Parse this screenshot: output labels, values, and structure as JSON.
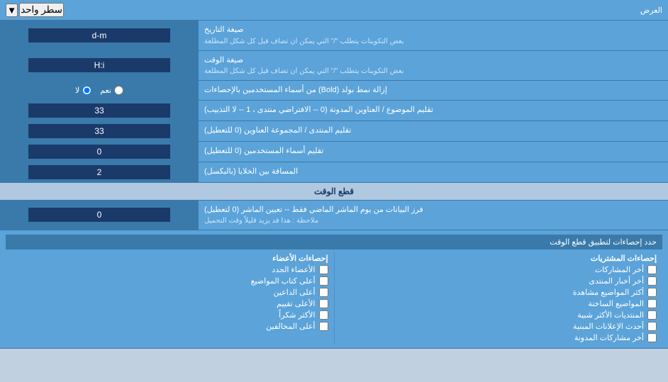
{
  "header": {
    "label": "العرض",
    "dropdown_label": "سطر واحد",
    "dropdown_arrow": "▼"
  },
  "rows": [
    {
      "id": "date_format",
      "label": "صيغة التاريخ",
      "sublabel": "بعض التكوينات يتطلب \"/\" التي يمكن ان تضاف قبل كل شكل المطلعة",
      "value": "d-m",
      "type": "text"
    },
    {
      "id": "time_format",
      "label": "صيغة الوقت",
      "sublabel": "بعض التكوينات يتطلب \"/\" التي يمكن ان تضاف قبل كل شكل المطلعة",
      "value": "H:i",
      "type": "text"
    },
    {
      "id": "bold_usernames",
      "label": "إزالة نمط بولد (Bold) من أسماء المستخدمين بالإحصاءات",
      "value": "",
      "type": "radio",
      "options": [
        "نعم",
        "لا"
      ],
      "selected": "لا"
    },
    {
      "id": "topic_titles",
      "label": "تقليم الموضوع / العناوين المدونة (0 -- الافتراضي منتدى ، 1 -- لا التذييب)",
      "value": "33",
      "type": "text"
    },
    {
      "id": "forum_group",
      "label": "تقليم المنتدى / المجموعة العناوين (0 للتعطيل)",
      "value": "33",
      "type": "text"
    },
    {
      "id": "user_names",
      "label": "تقليم أسماء المستخدمين (0 للتعطيل)",
      "value": "0",
      "type": "text"
    },
    {
      "id": "cell_gap",
      "label": "المسافة بين الخلايا (بالبكسل)",
      "value": "2",
      "type": "text"
    }
  ],
  "section_realtime": {
    "title": "قطع الوقت",
    "row": {
      "label": "فرز البيانات من يوم الماشر الماضي فقط -- تعيين الماشر (0 لتعطيل)",
      "note": "ملاحظة : هذا قد يزيد قليلاً وقت التحميل",
      "value": "0"
    },
    "stats_label": "حدد إحصاءات لتطبيق قطع الوقت"
  },
  "checkboxes": {
    "col1": {
      "header": "إحصاءات المشتريات",
      "items": [
        "أخر المشاركات",
        "أخر أخبار المنتدى",
        "أكثر المواضيع مشاهدة",
        "المواضيع الساخنة",
        "المنتديات الأكثر شبية",
        "أحدث الإعلانات المبنية",
        "أخر مشاركات المدونة"
      ]
    },
    "col2": {
      "header": "إحصاءات الأعضاء",
      "items": [
        "الأعضاء الجدد",
        "أعلى كتاب المواضيع",
        "أعلى الداعين",
        "الأعلى تقييم",
        "الأكثر شكراً",
        "أعلى المخالفين"
      ]
    }
  }
}
